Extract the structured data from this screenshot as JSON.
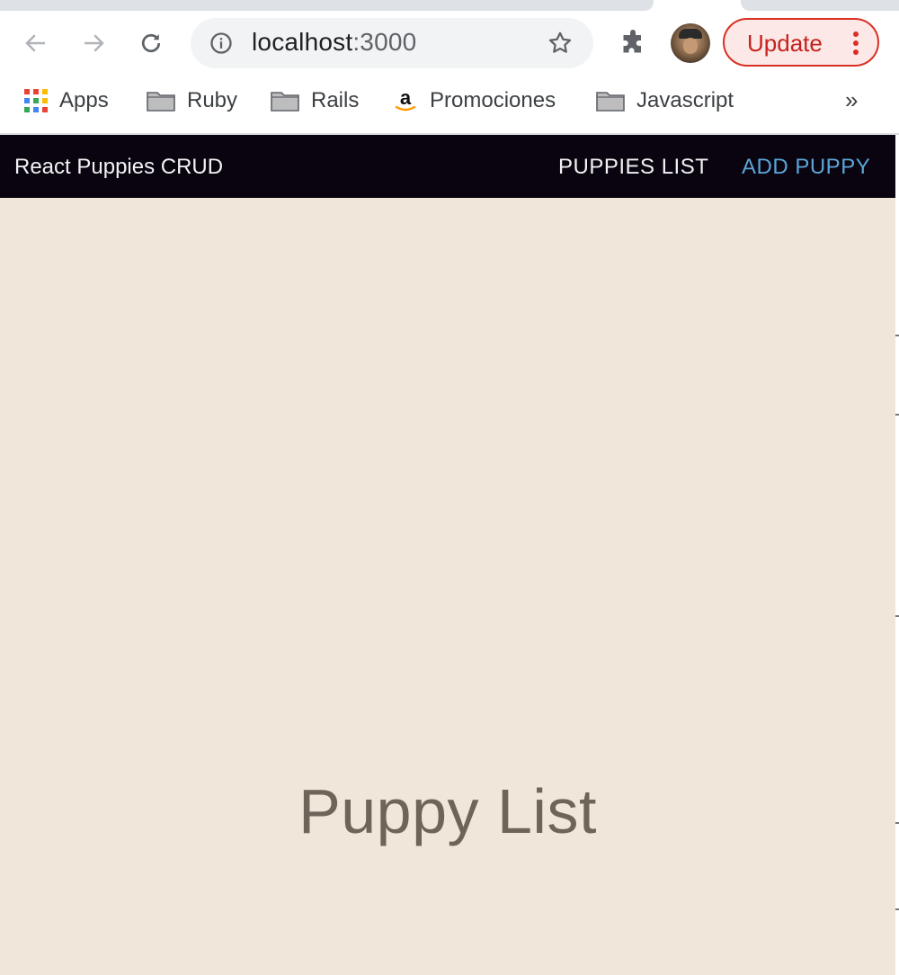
{
  "browser": {
    "url_host": "localhost",
    "url_port": ":3000",
    "update_label": "Update",
    "bookmarks": [
      {
        "label": "Apps",
        "icon": "apps-grid-icon"
      },
      {
        "label": "Ruby",
        "icon": "folder-icon"
      },
      {
        "label": "Rails",
        "icon": "folder-icon"
      },
      {
        "label": "Promociones",
        "icon": "amazon-icon"
      },
      {
        "label": "Javascript",
        "icon": "folder-icon"
      }
    ],
    "more_bookmarks": "»",
    "colors": {
      "update_accent": "#d93025",
      "omnibox_bg": "#f1f3f4"
    }
  },
  "app": {
    "brand": "React Puppies CRUD",
    "nav": {
      "puppies_list": "PUPPIES LIST",
      "add_puppy": "ADD PUPPY"
    },
    "heading": "Puppy List",
    "colors": {
      "navbar_bg": "#0a0410",
      "page_bg": "#f0e6da",
      "active_link": "#5aa6d8"
    }
  }
}
